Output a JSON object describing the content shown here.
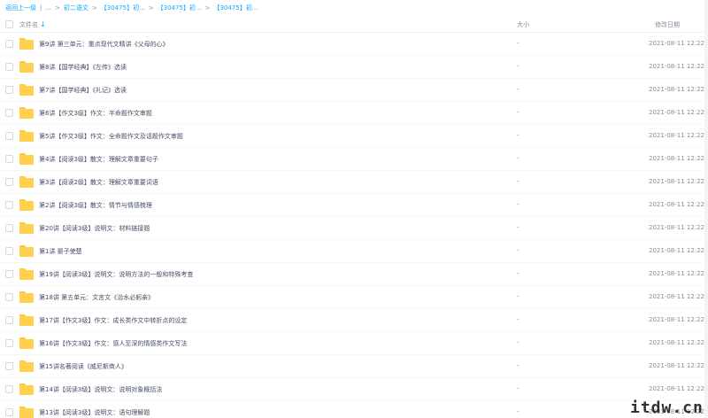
{
  "breadcrumb": {
    "back": "返回上一级",
    "items": [
      "...",
      "初二语文",
      "【30475】初...",
      "【30475】初...",
      "【30475】初..."
    ],
    "separators": [
      "|",
      ">",
      ">",
      ">",
      ">"
    ]
  },
  "header": {
    "filename": "文件名",
    "sort_icon": "↓",
    "size": "大小",
    "modified": "修改日期"
  },
  "rows": [
    {
      "name": "第9讲 第三单元：重点现代文精讲《父母的心》",
      "size": "-",
      "date": "2021-08-11 12:22"
    },
    {
      "name": "第8讲【国学经典】《左传》选读",
      "size": "-",
      "date": "2021-08-11 12:22"
    },
    {
      "name": "第7讲【国学经典】《礼记》选读",
      "size": "-",
      "date": "2021-08-11 12:22"
    },
    {
      "name": "第6讲【作文3级】作文：半命题作文审题",
      "size": "-",
      "date": "2021-08-11 12:22"
    },
    {
      "name": "第5讲【作文3级】作文：全命题作文及话题作文审题",
      "size": "-",
      "date": "2021-08-11 12:22"
    },
    {
      "name": "第4讲【阅读3级】散文：理解文章重要句子",
      "size": "-",
      "date": "2021-08-11 12:22"
    },
    {
      "name": "第3讲【阅读2级】散文：理解文章重要词语",
      "size": "-",
      "date": "2021-08-11 12:22"
    },
    {
      "name": "第2讲【阅读3级】散文：情节与情感梳理",
      "size": "-",
      "date": "2021-08-11 12:22"
    },
    {
      "name": "第20讲【阅读3级】说明文：材料链接题",
      "size": "-",
      "date": "2021-08-11 12:22"
    },
    {
      "name": "第1讲 晏子使楚",
      "size": "-",
      "date": "2021-08-11 12:22"
    },
    {
      "name": "第19讲【阅读3级】说明文：说明方法的一般和特殊考查",
      "size": "-",
      "date": "2021-08-11 12:22"
    },
    {
      "name": "第18讲 第五单元：文言文《治水必躬亲》",
      "size": "-",
      "date": "2021-08-11 12:22"
    },
    {
      "name": "第17讲【作文3级】作文：成长类作文中转折点的设定",
      "size": "-",
      "date": "2021-08-11 12:22"
    },
    {
      "name": "第16讲【作文3级】作文：感人至深的情感类作文写法",
      "size": "-",
      "date": "2021-08-11 12:22"
    },
    {
      "name": "第15讲名著阅读《威尼斯商人》",
      "size": "-",
      "date": "2021-08-11 12:22"
    },
    {
      "name": "第14讲【阅读3级】说明文：说明对象概括法",
      "size": "-",
      "date": "2021-08-11 12:22"
    },
    {
      "name": "第13讲【阅读3级】说明文：语句理解题",
      "size": "-",
      "date": "2021-08-11 12:22"
    }
  ],
  "watermark": "itdw.cn",
  "colors": {
    "accent": "#09aaff",
    "folder": "#ffd04f",
    "text": "#424e67",
    "muted": "#878c9c"
  }
}
